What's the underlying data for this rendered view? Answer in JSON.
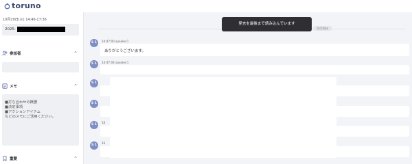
{
  "app": {
    "logo_text": "toruno",
    "datetime": "10月29日(火) 14:46-17:36",
    "title_prefix": "2025-"
  },
  "sidebar": {
    "participants_label": "参加者",
    "memo_label": "メモ",
    "memo_lines": [
      "■打ち合わせの概要",
      "■決定事項",
      "■アクションアイテム",
      "などのメモにご活用ください。"
    ],
    "important_label": "重要"
  },
  "toast": {
    "text": "発言を最後まで読み込んでいます"
  },
  "resume_chip": {
    "text": "録音開始"
  },
  "transcript": [
    {
      "avatar": "S 1",
      "meta": "14:47:00 speaker1",
      "text": "ありがとうございます。"
    },
    {
      "avatar": "S 1",
      "meta": "14:47:04 speaker1",
      "text": ""
    },
    {
      "avatar": "S 1",
      "meta": "",
      "text": ""
    },
    {
      "avatar": "S 1",
      "meta": "",
      "text": ""
    },
    {
      "avatar": "S 1",
      "meta": "16",
      "text": ""
    },
    {
      "avatar": "S 1",
      "meta": "16",
      "text": ""
    }
  ]
}
